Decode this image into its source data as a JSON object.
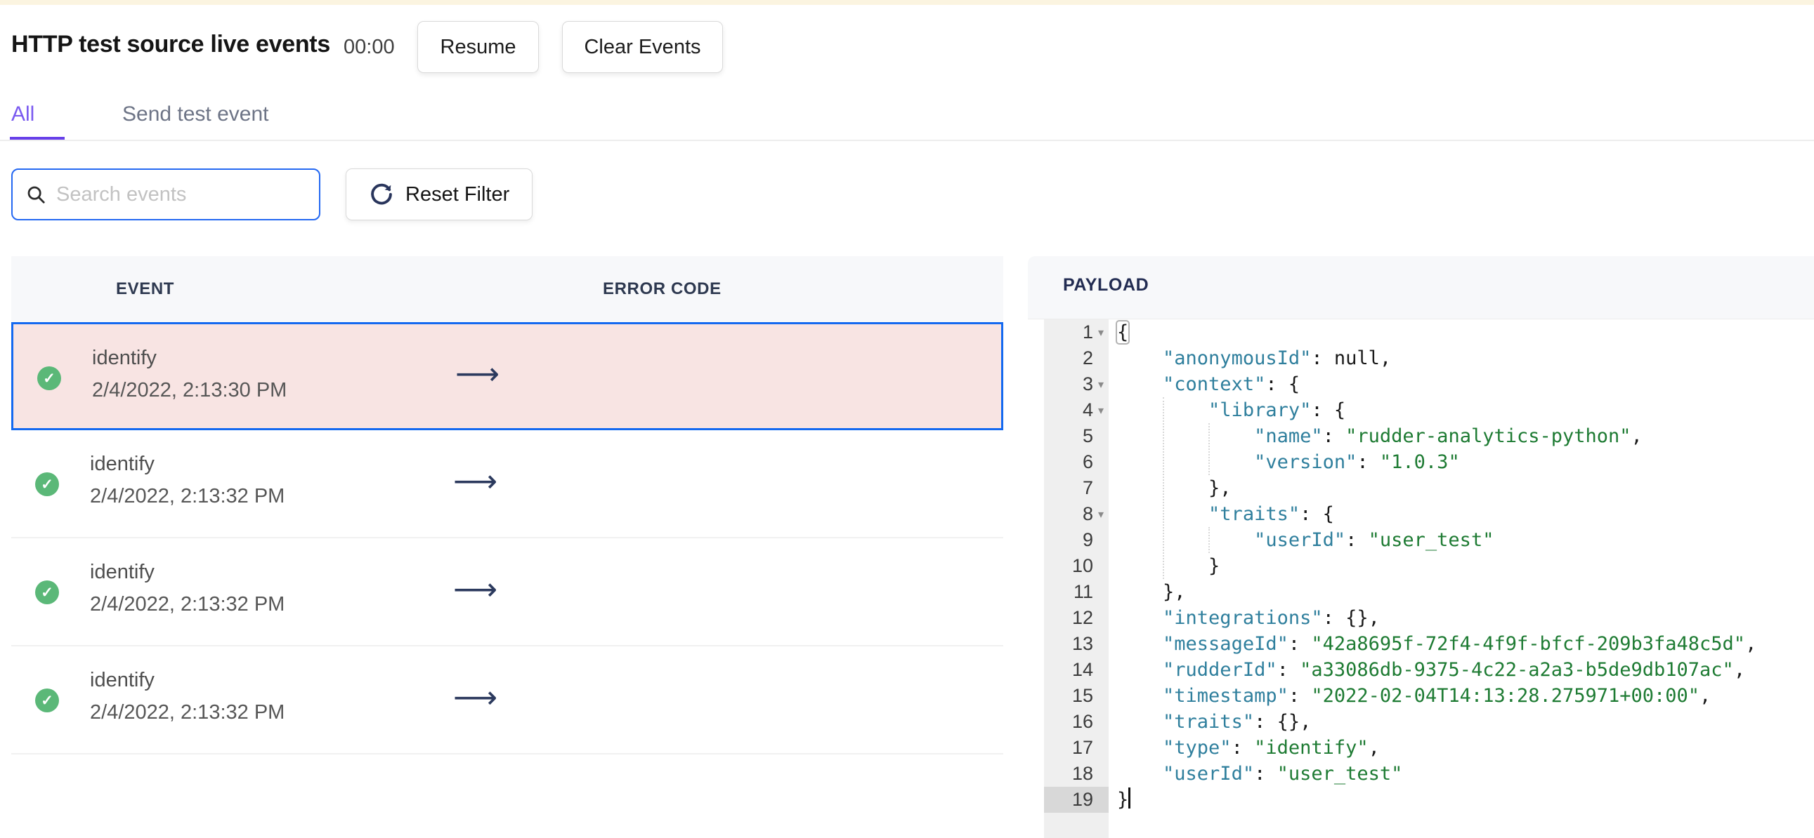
{
  "header": {
    "title": "HTTP test source live events",
    "timer": "00:00",
    "resume_label": "Resume",
    "clear_label": "Clear Events"
  },
  "tabs": [
    {
      "label": "All",
      "active": true
    },
    {
      "label": "Send test event",
      "active": false
    }
  ],
  "filters": {
    "search_placeholder": "Search events",
    "reset_label": "Reset Filter"
  },
  "table": {
    "columns": [
      "EVENT",
      "ERROR CODE"
    ],
    "check_glyph": "✓",
    "arrow_glyph": "⟶",
    "rows": [
      {
        "event": "identify",
        "time": "2/4/2022, 2:13:30 PM",
        "selected": true,
        "status": "success"
      },
      {
        "event": "identify",
        "time": "2/4/2022, 2:13:32 PM",
        "selected": false,
        "status": "success"
      },
      {
        "event": "identify",
        "time": "2/4/2022, 2:13:32 PM",
        "selected": false,
        "status": "success"
      },
      {
        "event": "identify",
        "time": "2/4/2022, 2:13:32 PM",
        "selected": false,
        "status": "success"
      }
    ]
  },
  "payload": {
    "title": "PAYLOAD",
    "fold_glyph": "▾",
    "lines": [
      {
        "n": 1,
        "fold": true,
        "segs": [
          {
            "t": "{",
            "c": "p",
            "hl": true
          }
        ]
      },
      {
        "n": 2,
        "segs": [
          {
            "t": "    ",
            "c": "p"
          },
          {
            "t": "\"anonymousId\"",
            "c": "k"
          },
          {
            "t": ": null,",
            "c": "p"
          }
        ]
      },
      {
        "n": 3,
        "fold": true,
        "segs": [
          {
            "t": "    ",
            "c": "p"
          },
          {
            "t": "\"context\"",
            "c": "k"
          },
          {
            "t": ": {",
            "c": "p"
          }
        ]
      },
      {
        "n": 4,
        "fold": true,
        "segs": [
          {
            "t": "        ",
            "c": "p"
          },
          {
            "t": "\"library\"",
            "c": "k"
          },
          {
            "t": ": {",
            "c": "p"
          }
        ]
      },
      {
        "n": 5,
        "segs": [
          {
            "t": "            ",
            "c": "p"
          },
          {
            "t": "\"name\"",
            "c": "k"
          },
          {
            "t": ": ",
            "c": "p"
          },
          {
            "t": "\"rudder-analytics-python\"",
            "c": "s"
          },
          {
            "t": ",",
            "c": "p"
          }
        ]
      },
      {
        "n": 6,
        "segs": [
          {
            "t": "            ",
            "c": "p"
          },
          {
            "t": "\"version\"",
            "c": "k"
          },
          {
            "t": ": ",
            "c": "p"
          },
          {
            "t": "\"1.0.3\"",
            "c": "s"
          }
        ]
      },
      {
        "n": 7,
        "segs": [
          {
            "t": "        },",
            "c": "p"
          }
        ]
      },
      {
        "n": 8,
        "fold": true,
        "segs": [
          {
            "t": "        ",
            "c": "p"
          },
          {
            "t": "\"traits\"",
            "c": "k"
          },
          {
            "t": ": {",
            "c": "p"
          }
        ]
      },
      {
        "n": 9,
        "segs": [
          {
            "t": "            ",
            "c": "p"
          },
          {
            "t": "\"userId\"",
            "c": "k"
          },
          {
            "t": ": ",
            "c": "p"
          },
          {
            "t": "\"user_test\"",
            "c": "s"
          }
        ]
      },
      {
        "n": 10,
        "segs": [
          {
            "t": "        }",
            "c": "p"
          }
        ]
      },
      {
        "n": 11,
        "segs": [
          {
            "t": "    },",
            "c": "p"
          }
        ]
      },
      {
        "n": 12,
        "segs": [
          {
            "t": "    ",
            "c": "p"
          },
          {
            "t": "\"integrations\"",
            "c": "k"
          },
          {
            "t": ": {},",
            "c": "p"
          }
        ]
      },
      {
        "n": 13,
        "segs": [
          {
            "t": "    ",
            "c": "p"
          },
          {
            "t": "\"messageId\"",
            "c": "k"
          },
          {
            "t": ": ",
            "c": "p"
          },
          {
            "t": "\"42a8695f-72f4-4f9f-bfcf-209b3fa48c5d\"",
            "c": "s"
          },
          {
            "t": ",",
            "c": "p"
          }
        ]
      },
      {
        "n": 14,
        "segs": [
          {
            "t": "    ",
            "c": "p"
          },
          {
            "t": "\"rudderId\"",
            "c": "k"
          },
          {
            "t": ": ",
            "c": "p"
          },
          {
            "t": "\"a33086db-9375-4c22-a2a3-b5de9db107ac\"",
            "c": "s"
          },
          {
            "t": ",",
            "c": "p"
          }
        ]
      },
      {
        "n": 15,
        "segs": [
          {
            "t": "    ",
            "c": "p"
          },
          {
            "t": "\"timestamp\"",
            "c": "k"
          },
          {
            "t": ": ",
            "c": "p"
          },
          {
            "t": "\"2022-02-04T14:13:28.275971+00:00\"",
            "c": "s"
          },
          {
            "t": ",",
            "c": "p"
          }
        ]
      },
      {
        "n": 16,
        "segs": [
          {
            "t": "    ",
            "c": "p"
          },
          {
            "t": "\"traits\"",
            "c": "k"
          },
          {
            "t": ": {},",
            "c": "p"
          }
        ]
      },
      {
        "n": 17,
        "segs": [
          {
            "t": "    ",
            "c": "p"
          },
          {
            "t": "\"type\"",
            "c": "k"
          },
          {
            "t": ": ",
            "c": "p"
          },
          {
            "t": "\"identify\"",
            "c": "s"
          },
          {
            "t": ",",
            "c": "p"
          }
        ]
      },
      {
        "n": 18,
        "segs": [
          {
            "t": "    ",
            "c": "p"
          },
          {
            "t": "\"userId\"",
            "c": "k"
          },
          {
            "t": ": ",
            "c": "p"
          },
          {
            "t": "\"user_test\"",
            "c": "s"
          }
        ]
      },
      {
        "n": 19,
        "active": true,
        "cursor": true,
        "segs": [
          {
            "t": "}",
            "c": "p"
          }
        ]
      }
    ]
  },
  "colors": {
    "accent_blue": "#1469f0",
    "search_border_blue": "#2468f2",
    "tab_purple": "#7a5af0",
    "ink_bar_purple": "#6740e9",
    "success_green": "#5bb878",
    "selected_row_pink": "#f8e4e3",
    "navy_icon": "#29355c",
    "json_key_teal": "#2f7f9d",
    "json_string_green": "#1e7b33",
    "top_banner_cream": "#fbf4e0",
    "panel_header_gray": "#f7f8fa"
  }
}
